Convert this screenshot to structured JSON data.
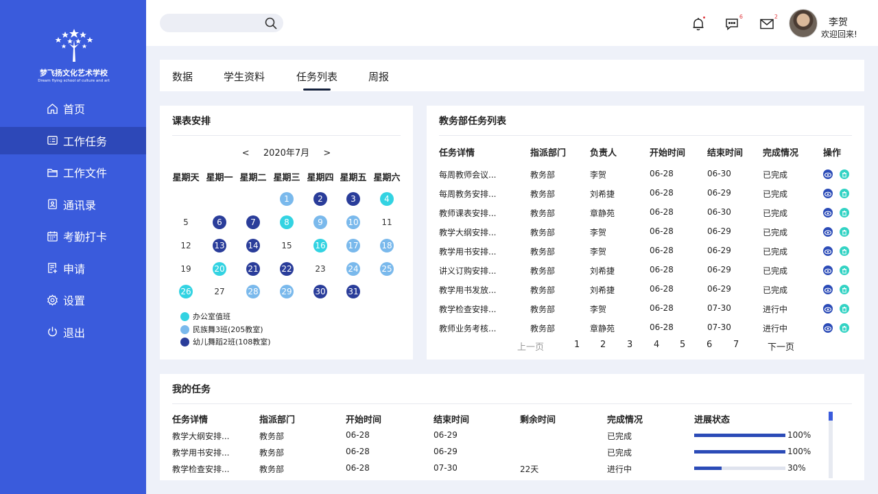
{
  "brand": {
    "name": "梦飞扬文化艺术学校",
    "subtitle": "Dream flying school of culture and art"
  },
  "nav": [
    {
      "label": "首页",
      "icon": "home-icon"
    },
    {
      "label": "工作任务",
      "icon": "task-icon"
    },
    {
      "label": "工作文件",
      "icon": "folder-icon"
    },
    {
      "label": "通讯录",
      "icon": "contacts-icon"
    },
    {
      "label": "考勤打卡",
      "icon": "calendar-icon"
    },
    {
      "label": "申请",
      "icon": "application-icon"
    },
    {
      "label": "设置",
      "icon": "gear-icon"
    },
    {
      "label": "退出",
      "icon": "power-icon"
    }
  ],
  "header": {
    "search_placeholder": "",
    "message_count": "6",
    "mail_count": "2",
    "user_name": "李贺",
    "greeting": "欢迎回来!"
  },
  "tabs": [
    "数据",
    "学生资料",
    "任务列表",
    "周报"
  ],
  "calendar": {
    "title": "课表安排",
    "month": "2020年7月",
    "prev": "<",
    "next": ">",
    "weekdays": [
      "星期天",
      "星期一",
      "星期二",
      "星期三",
      "星期四",
      "星期五",
      "星期六"
    ],
    "legend": [
      {
        "label": "办公室值班",
        "color": "#33d3e2"
      },
      {
        "label": "民族舞3班(205教室)",
        "color": "#7ab9ec"
      },
      {
        "label": "幼儿舞蹈2班(108教室)",
        "color": "#2a3d9a"
      }
    ],
    "days": [
      {
        "d": "1",
        "c": 2
      },
      {
        "d": "2",
        "c": 3
      },
      {
        "d": "3",
        "c": 3
      },
      {
        "d": "4",
        "c": 1
      },
      {
        "d": "5",
        "c": 0
      },
      {
        "d": "6",
        "c": 3
      },
      {
        "d": "7",
        "c": 3
      },
      {
        "d": "8",
        "c": 1
      },
      {
        "d": "9",
        "c": 2
      },
      {
        "d": "10",
        "c": 2
      },
      {
        "d": "11",
        "c": 0
      },
      {
        "d": "12",
        "c": 0
      },
      {
        "d": "13",
        "c": 3
      },
      {
        "d": "14",
        "c": 3
      },
      {
        "d": "15",
        "c": 0
      },
      {
        "d": "16",
        "c": 1
      },
      {
        "d": "17",
        "c": 2
      },
      {
        "d": "18",
        "c": 2
      },
      {
        "d": "19",
        "c": 0
      },
      {
        "d": "20",
        "c": 1
      },
      {
        "d": "21",
        "c": 3
      },
      {
        "d": "22",
        "c": 3
      },
      {
        "d": "23",
        "c": 0
      },
      {
        "d": "24",
        "c": 2
      },
      {
        "d": "25",
        "c": 2
      },
      {
        "d": "26",
        "c": 1
      },
      {
        "d": "27",
        "c": 0
      },
      {
        "d": "28",
        "c": 2
      },
      {
        "d": "29",
        "c": 2
      },
      {
        "d": "30",
        "c": 3
      },
      {
        "d": "31",
        "c": 3
      }
    ]
  },
  "task_list": {
    "title": "教务部任务列表",
    "headers": [
      "任务详情",
      "指派部门",
      "负责人",
      "开始时间",
      "结束时间",
      "完成情况",
      "操作"
    ],
    "rows": [
      [
        "每周教师会议...",
        "教务部",
        "李贺",
        "06-28",
        "06-30",
        "已完成"
      ],
      [
        "每周教务安排...",
        "教务部",
        "刘希捷",
        "06-28",
        "06-29",
        "已完成"
      ],
      [
        "教师课表安排...",
        "教务部",
        "章静苑",
        "06-28",
        "06-30",
        "已完成"
      ],
      [
        "教学大纲安排...",
        "教务部",
        "李贺",
        "06-28",
        "06-29",
        "已完成"
      ],
      [
        "教学用书安排...",
        "教务部",
        "李贺",
        "06-28",
        "06-29",
        "已完成"
      ],
      [
        "讲义订购安排...",
        "教务部",
        "刘希捷",
        "06-28",
        "06-29",
        "已完成"
      ],
      [
        "教学用书发放...",
        "教务部",
        "刘希捷",
        "06-28",
        "06-29",
        "已完成"
      ],
      [
        "教学检查安排...",
        "教务部",
        "李贺",
        "06-28",
        "07-30",
        "进行中"
      ],
      [
        "教师业务考核...",
        "教务部",
        "章静苑",
        "06-28",
        "07-30",
        "进行中"
      ]
    ],
    "pager": {
      "prev": "上一页",
      "pages": [
        "1",
        "2",
        "3",
        "4",
        "5",
        "6",
        "7"
      ],
      "next": "下一页"
    }
  },
  "my_tasks": {
    "title": "我的任务",
    "headers": [
      "任务详情",
      "指派部门",
      "开始时间",
      "结束时间",
      "剩余时间",
      "完成情况",
      "进展状态"
    ],
    "rows": [
      {
        "task": "教学大纲安排...",
        "dept": "教务部",
        "start": "06-28",
        "end": "06-29",
        "remain": "",
        "status": "已完成",
        "progress": 100,
        "pct": "100%"
      },
      {
        "task": "教学用书安排...",
        "dept": "教务部",
        "start": "06-28",
        "end": "06-29",
        "remain": "",
        "status": "已完成",
        "progress": 100,
        "pct": "100%"
      },
      {
        "task": "教学检查安排...",
        "dept": "教务部",
        "start": "06-28",
        "end": "07-30",
        "remain": "22天",
        "status": "进行中",
        "progress": 30,
        "pct": "30%"
      }
    ]
  }
}
